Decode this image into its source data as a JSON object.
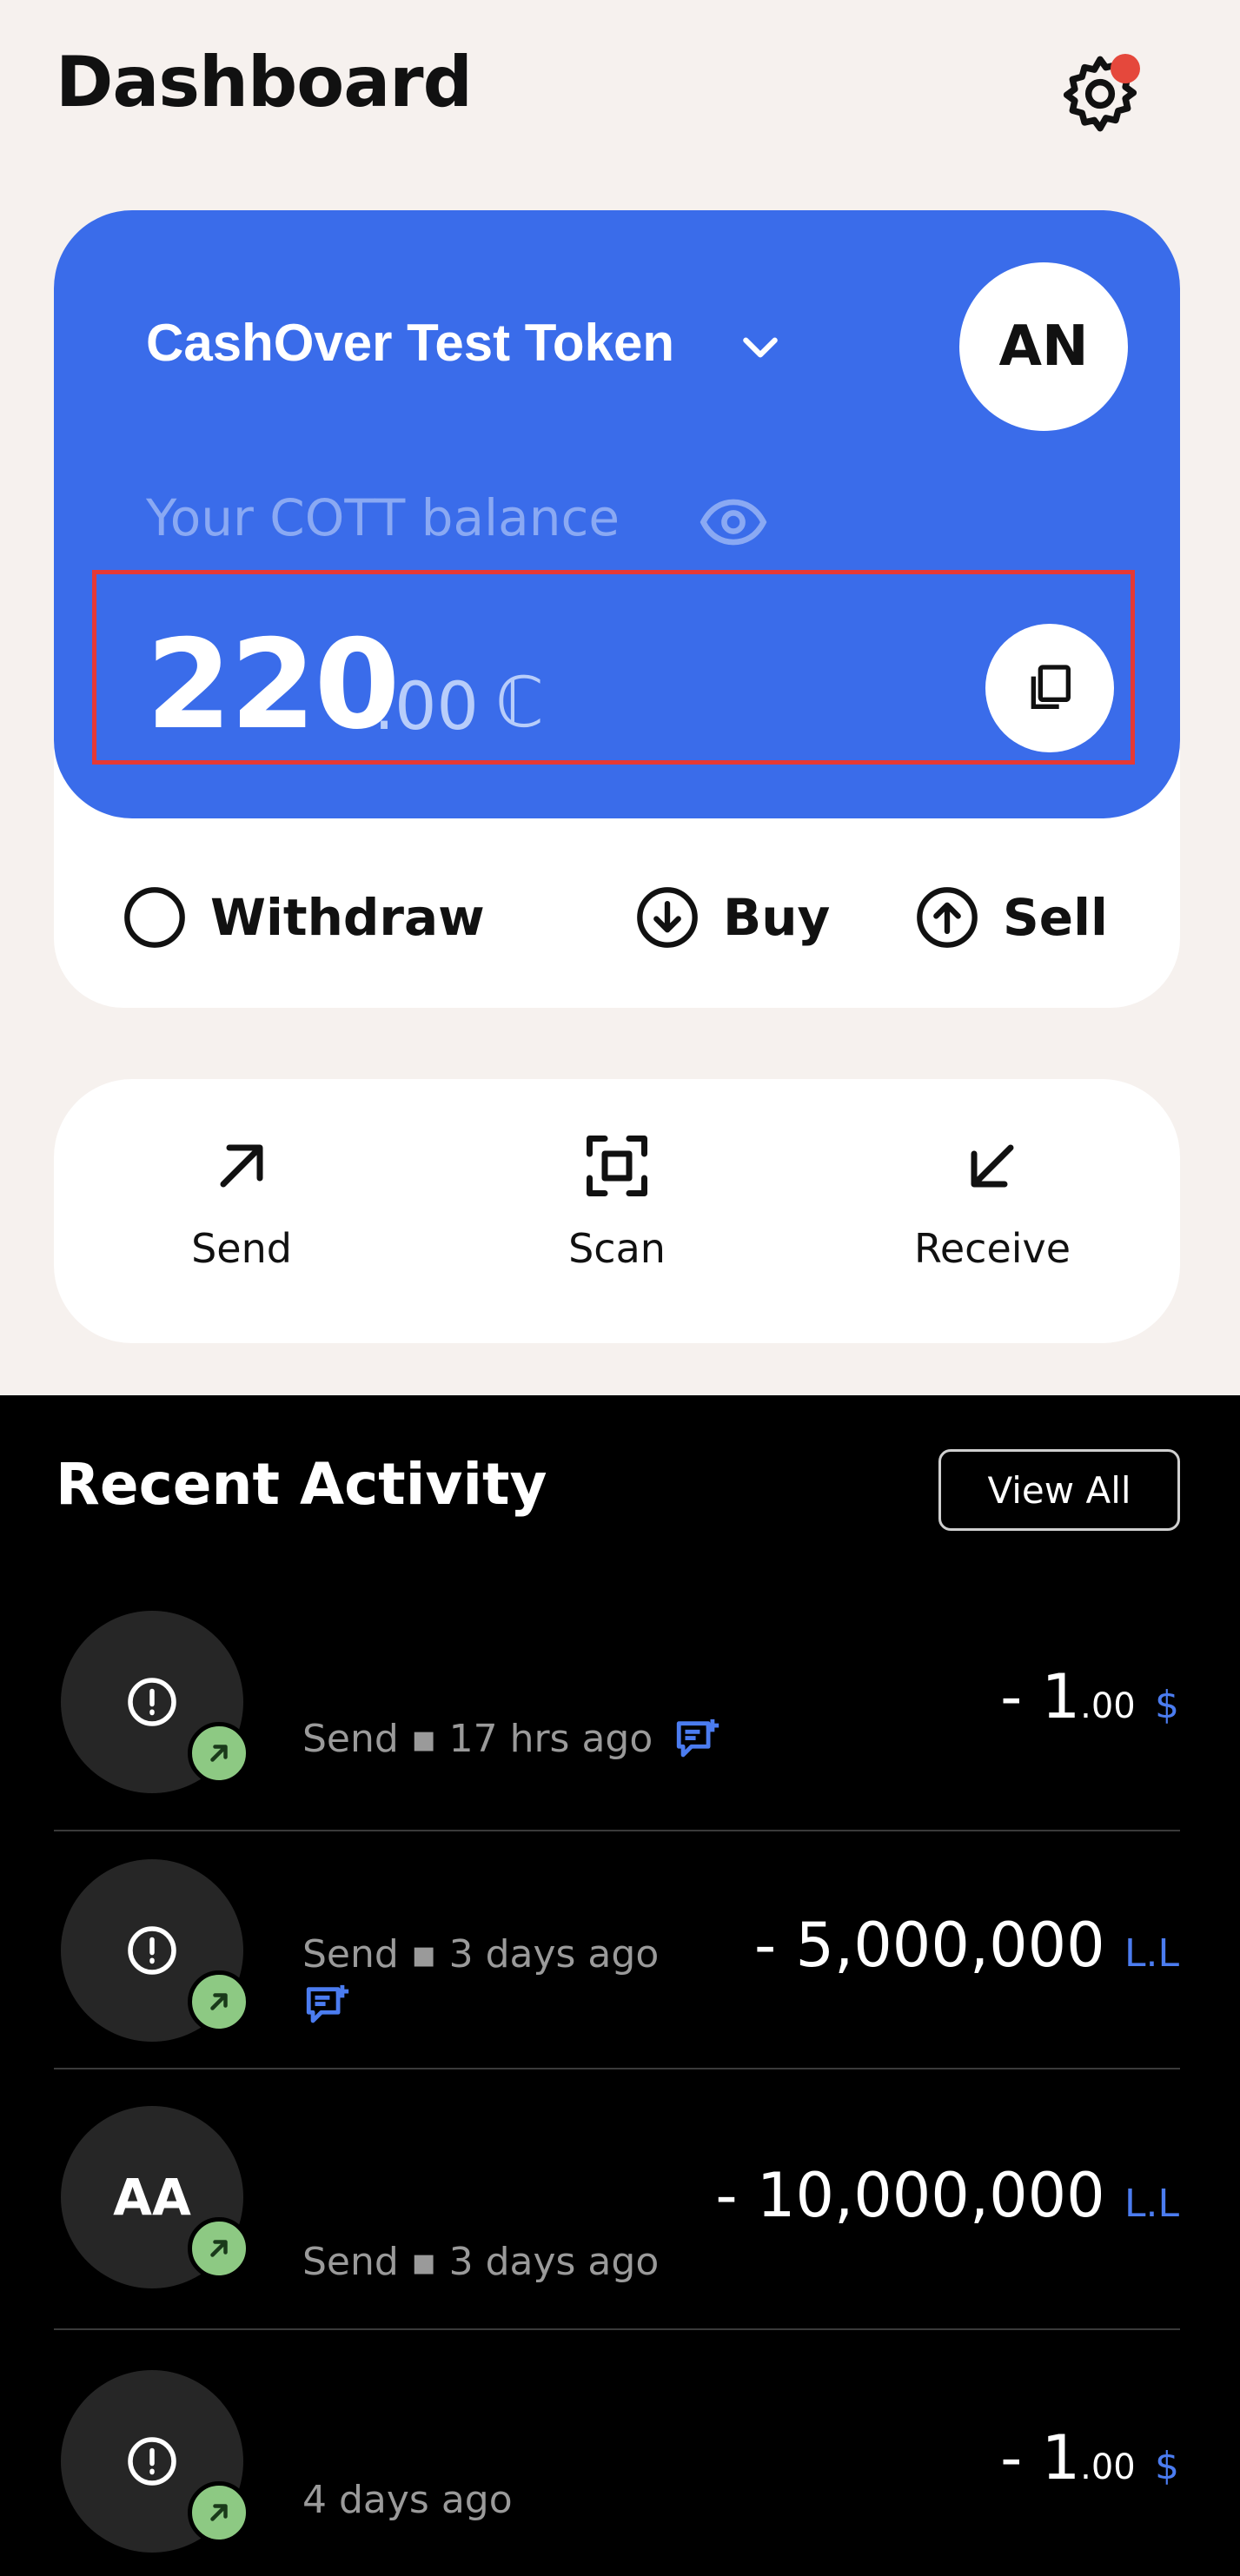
{
  "header": {
    "title": "Dashboard",
    "settings_icon": "gear-icon",
    "notification_dot_color": "#e5483c"
  },
  "token_card": {
    "token_name": "CashOver Test Token",
    "avatar_initials": "AN",
    "balance_label": "Your COTT balance",
    "balance_integer": "220",
    "balance_decimal": ".00",
    "currency_symbol": "ℂ",
    "card_color": "#3a6cea"
  },
  "card_actions": [
    {
      "label": "Withdraw",
      "icon": "circle-icon"
    },
    {
      "label": "Buy",
      "icon": "arrow-down-circle-icon"
    },
    {
      "label": "Sell",
      "icon": "arrow-up-circle-icon"
    }
  ],
  "quick_actions": [
    {
      "label": "Send",
      "icon": "arrow-up-right-icon"
    },
    {
      "label": "Scan",
      "icon": "scan-icon"
    },
    {
      "label": "Receive",
      "icon": "arrow-down-left-icon"
    }
  ],
  "activity": {
    "title": "Recent Activity",
    "view_all": "View All",
    "items": [
      {
        "avatar": "!",
        "meta": "Send ▪ 17 hrs ago",
        "has_note": true,
        "amount_main": "- 1",
        "amount_dec": ".00",
        "currency": "$"
      },
      {
        "avatar": "!",
        "meta": "Send ▪ 3 days ago",
        "has_note": true,
        "amount_main": "- 5,000,000",
        "amount_dec": "",
        "currency": "L.L"
      },
      {
        "avatar": "AA",
        "meta": "Send ▪ 3 days ago",
        "has_note": false,
        "amount_main": "- 10,000,000",
        "amount_dec": "",
        "currency": "L.L"
      },
      {
        "avatar": "!",
        "meta": "4 days ago",
        "has_note": false,
        "amount_main": "- 1",
        "amount_dec": ".00",
        "currency": "$"
      }
    ]
  }
}
